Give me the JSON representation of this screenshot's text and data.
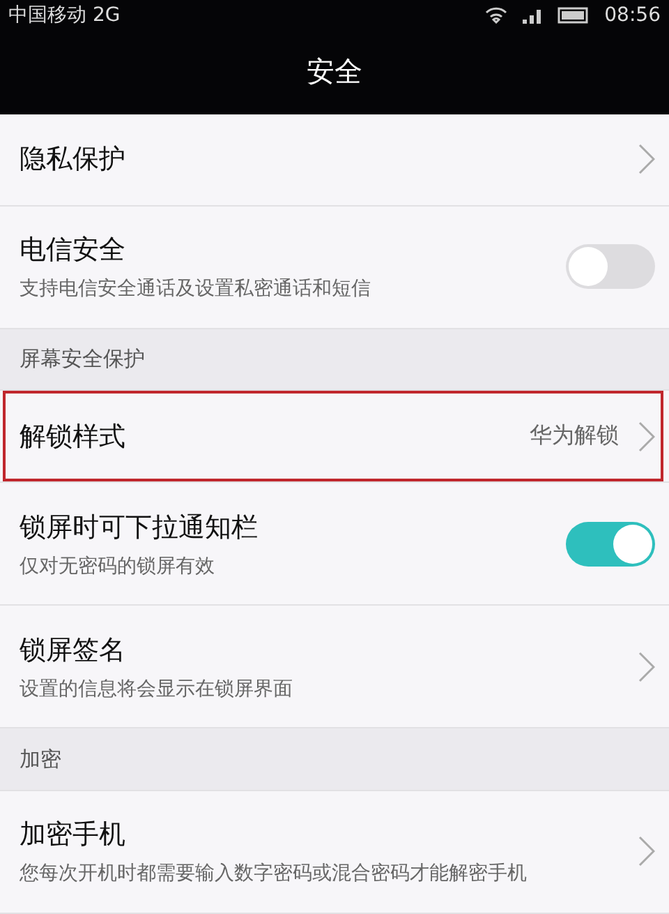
{
  "status_bar": {
    "carrier": "中国移动 2G",
    "time": "08:56"
  },
  "title": "安全",
  "items": [
    {
      "kind": "row",
      "title": "隐私保护",
      "highlighted": false
    },
    {
      "kind": "row",
      "title": "电信安全",
      "subtitle": "支持电信安全通话及设置私密通话和短信",
      "toggle": {
        "on": false
      },
      "highlighted": false
    },
    {
      "kind": "header",
      "title": "屏幕安全保护"
    },
    {
      "kind": "row",
      "title": "解锁样式",
      "value": "华为解锁",
      "highlighted": true
    },
    {
      "kind": "row",
      "title": "锁屏时可下拉通知栏",
      "subtitle": "仅对无密码的锁屏有效",
      "toggle": {
        "on": true
      },
      "highlighted": false
    },
    {
      "kind": "row",
      "title": "锁屏签名",
      "subtitle": "设置的信息将会显示在锁屏界面",
      "highlighted": false
    },
    {
      "kind": "header",
      "title": "加密"
    },
    {
      "kind": "row",
      "title": "加密手机",
      "subtitle": "您每次开机时都需要输入数字密码或混合密码才能解密手机",
      "highlighted": false
    }
  ]
}
